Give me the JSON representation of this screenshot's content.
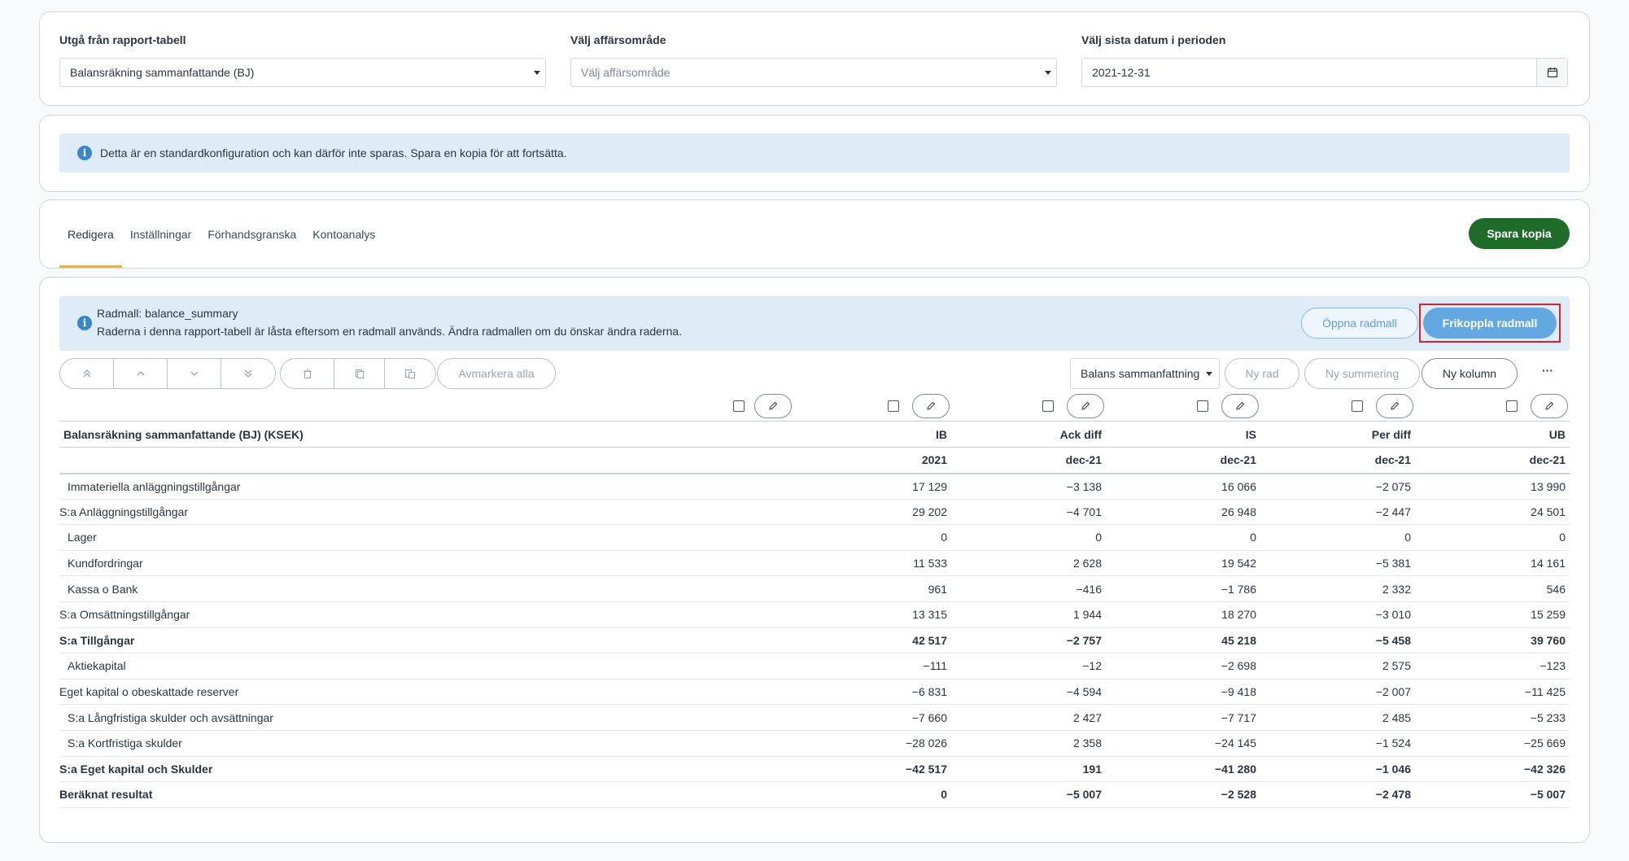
{
  "filters": {
    "report_table": {
      "label": "Utgå från rapport-tabell",
      "value": "Balansräkning sammanfattande (BJ)"
    },
    "business_area": {
      "label": "Välj affärsområde",
      "placeholder": "Välj affärsområde"
    },
    "date": {
      "label": "Välj sista datum i perioden",
      "value": "2021-12-31"
    }
  },
  "notice": {
    "text": "Detta är en standardkonfiguration och kan därför inte sparas. Spara en kopia för att fortsätta."
  },
  "tabs": [
    {
      "label": "Redigera",
      "active": true
    },
    {
      "label": "Inställningar",
      "active": false
    },
    {
      "label": "Förhandsgranska",
      "active": false
    },
    {
      "label": "Kontoanalys",
      "active": false
    }
  ],
  "save_copy_label": "Spara kopia",
  "template_info": {
    "title": "Radmall: balance_summary",
    "text": "Raderna i denna rapport-tabell är låsta eftersom en radmall används. Ändra radmallen om du önskar ändra raderna.",
    "open_label": "Öppna radmall",
    "detach_label": "Frikoppla radmall"
  },
  "toolbar": {
    "deselect_all": "Avmarkera alla",
    "summary_dropdown": "Balans sammanfattning",
    "new_row": "Ny rad",
    "new_summary": "Ny summering",
    "new_column": "Ny kolumn",
    "more": "···"
  },
  "table": {
    "title": "Balansräkning sammanfattande (BJ) (KSEK)",
    "columns": [
      "IB",
      "Ack diff",
      "IS",
      "Per diff",
      "UB"
    ],
    "periods": [
      "2021",
      "dec-21",
      "dec-21",
      "dec-21",
      "dec-21"
    ],
    "rows": [
      {
        "label": "Immateriella anläggningstillgångar",
        "indent": true,
        "bold": false,
        "values": [
          "17 129",
          "−3 138",
          "16 066",
          "−2 075",
          "13 990"
        ]
      },
      {
        "label": "S:a Anläggningstillgångar",
        "indent": false,
        "bold": false,
        "values": [
          "29 202",
          "−4 701",
          "26 948",
          "−2 447",
          "24 501"
        ]
      },
      {
        "label": "Lager",
        "indent": true,
        "bold": false,
        "values": [
          "0",
          "0",
          "0",
          "0",
          "0"
        ]
      },
      {
        "label": "Kundfordringar",
        "indent": true,
        "bold": false,
        "values": [
          "11 533",
          "2 628",
          "19 542",
          "−5 381",
          "14 161"
        ]
      },
      {
        "label": "Kassa o Bank",
        "indent": true,
        "bold": false,
        "values": [
          "961",
          "−416",
          "−1 786",
          "2 332",
          "546"
        ]
      },
      {
        "label": "S:a Omsättningstillgångar",
        "indent": false,
        "bold": false,
        "values": [
          "13 315",
          "1 944",
          "18 270",
          "−3 010",
          "15 259"
        ]
      },
      {
        "label": "S:a Tillgångar",
        "indent": false,
        "bold": true,
        "values": [
          "42 517",
          "−2 757",
          "45 218",
          "−5 458",
          "39 760"
        ]
      },
      {
        "label": "Aktiekapital",
        "indent": true,
        "bold": false,
        "values": [
          "−111",
          "−12",
          "−2 698",
          "2 575",
          "−123"
        ]
      },
      {
        "label": "Eget kapital o obeskattade reserver",
        "indent": false,
        "bold": false,
        "values": [
          "−6 831",
          "−4 594",
          "−9 418",
          "−2 007",
          "−11 425"
        ]
      },
      {
        "label": "S:a Långfristiga skulder och avsättningar",
        "indent": true,
        "bold": false,
        "values": [
          "−7 660",
          "2 427",
          "−7 717",
          "2 485",
          "−5 233"
        ]
      },
      {
        "label": "S:a Kortfristiga skulder",
        "indent": true,
        "bold": false,
        "values": [
          "−28 026",
          "2 358",
          "−24 145",
          "−1 524",
          "−25 669"
        ]
      },
      {
        "label": "S:a Eget kapital och Skulder",
        "indent": false,
        "bold": true,
        "values": [
          "−42 517",
          "191",
          "−41 280",
          "−1 046",
          "−42 326"
        ]
      },
      {
        "label": "Beräknat resultat",
        "indent": false,
        "bold": true,
        "values": [
          "0",
          "−5 007",
          "−2 528",
          "−2 478",
          "−5 007"
        ]
      }
    ]
  }
}
